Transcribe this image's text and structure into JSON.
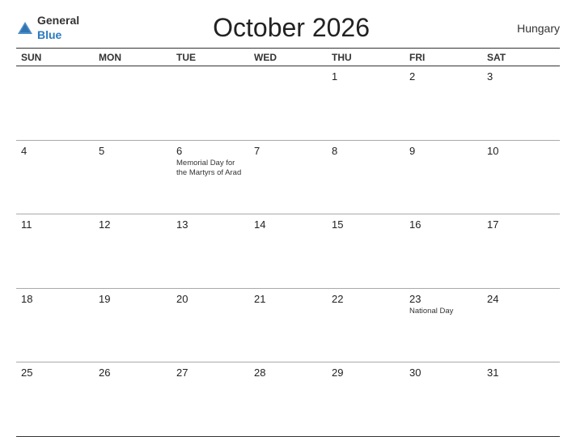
{
  "header": {
    "logo_general": "General",
    "logo_blue": "Blue",
    "title": "October 2026",
    "country": "Hungary"
  },
  "dayHeaders": [
    "SUN",
    "MON",
    "TUE",
    "WED",
    "THU",
    "FRI",
    "SAT"
  ],
  "weeks": [
    [
      {
        "num": "",
        "event": ""
      },
      {
        "num": "",
        "event": ""
      },
      {
        "num": "",
        "event": ""
      },
      {
        "num": "",
        "event": ""
      },
      {
        "num": "1",
        "event": ""
      },
      {
        "num": "2",
        "event": ""
      },
      {
        "num": "3",
        "event": ""
      }
    ],
    [
      {
        "num": "4",
        "event": ""
      },
      {
        "num": "5",
        "event": ""
      },
      {
        "num": "6",
        "event": "Memorial Day for the Martyrs of Arad"
      },
      {
        "num": "7",
        "event": ""
      },
      {
        "num": "8",
        "event": ""
      },
      {
        "num": "9",
        "event": ""
      },
      {
        "num": "10",
        "event": ""
      }
    ],
    [
      {
        "num": "11",
        "event": ""
      },
      {
        "num": "12",
        "event": ""
      },
      {
        "num": "13",
        "event": ""
      },
      {
        "num": "14",
        "event": ""
      },
      {
        "num": "15",
        "event": ""
      },
      {
        "num": "16",
        "event": ""
      },
      {
        "num": "17",
        "event": ""
      }
    ],
    [
      {
        "num": "18",
        "event": ""
      },
      {
        "num": "19",
        "event": ""
      },
      {
        "num": "20",
        "event": ""
      },
      {
        "num": "21",
        "event": ""
      },
      {
        "num": "22",
        "event": ""
      },
      {
        "num": "23",
        "event": "National Day"
      },
      {
        "num": "24",
        "event": ""
      }
    ],
    [
      {
        "num": "25",
        "event": ""
      },
      {
        "num": "26",
        "event": ""
      },
      {
        "num": "27",
        "event": ""
      },
      {
        "num": "28",
        "event": ""
      },
      {
        "num": "29",
        "event": ""
      },
      {
        "num": "30",
        "event": ""
      },
      {
        "num": "31",
        "event": ""
      }
    ]
  ]
}
